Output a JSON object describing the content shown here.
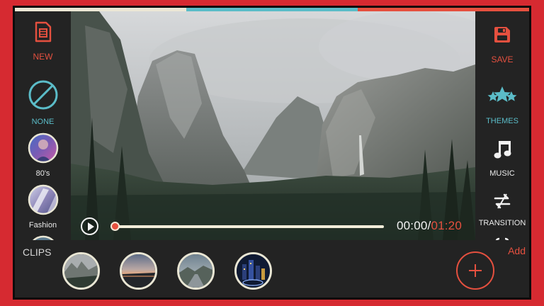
{
  "colors": {
    "accent": "#e5503f",
    "teal": "#5bbcc8",
    "frame_red": "#d62a31",
    "panel": "#232323",
    "light": "#e9e6d4"
  },
  "topbar": {
    "segments": [
      "#ece7d5",
      "#5bbcc8",
      "#e5503f"
    ]
  },
  "left_panel": {
    "items": [
      {
        "label": "NEW",
        "icon": "film-file-icon"
      },
      {
        "label": "NONE",
        "icon": "no-filter-icon"
      },
      {
        "label": "80's",
        "icon": "80s-filter-thumbnail"
      },
      {
        "label": "Fashion",
        "icon": "fashion-filter-thumbnail"
      },
      {
        "label": "",
        "icon": "filter-thumbnail-partial"
      }
    ]
  },
  "right_panel": {
    "items": [
      {
        "label": "SAVE",
        "icon": "save-floppy-icon"
      },
      {
        "label": "THEMES",
        "icon": "stars-icon"
      },
      {
        "label": "MUSIC",
        "icon": "music-note-icon"
      },
      {
        "label": "TRANSITION",
        "icon": "transition-icon"
      }
    ]
  },
  "player": {
    "current_time": "00:00",
    "separator": "/",
    "duration": "01:20",
    "progress": 0
  },
  "bottom": {
    "clips_label": "CLIPS",
    "add_label": "Add",
    "clips": [
      "valley-clip-thumbnail",
      "sunset-clip-thumbnail",
      "landscape-clip-thumbnail",
      "night-city-clip-thumbnail"
    ]
  }
}
